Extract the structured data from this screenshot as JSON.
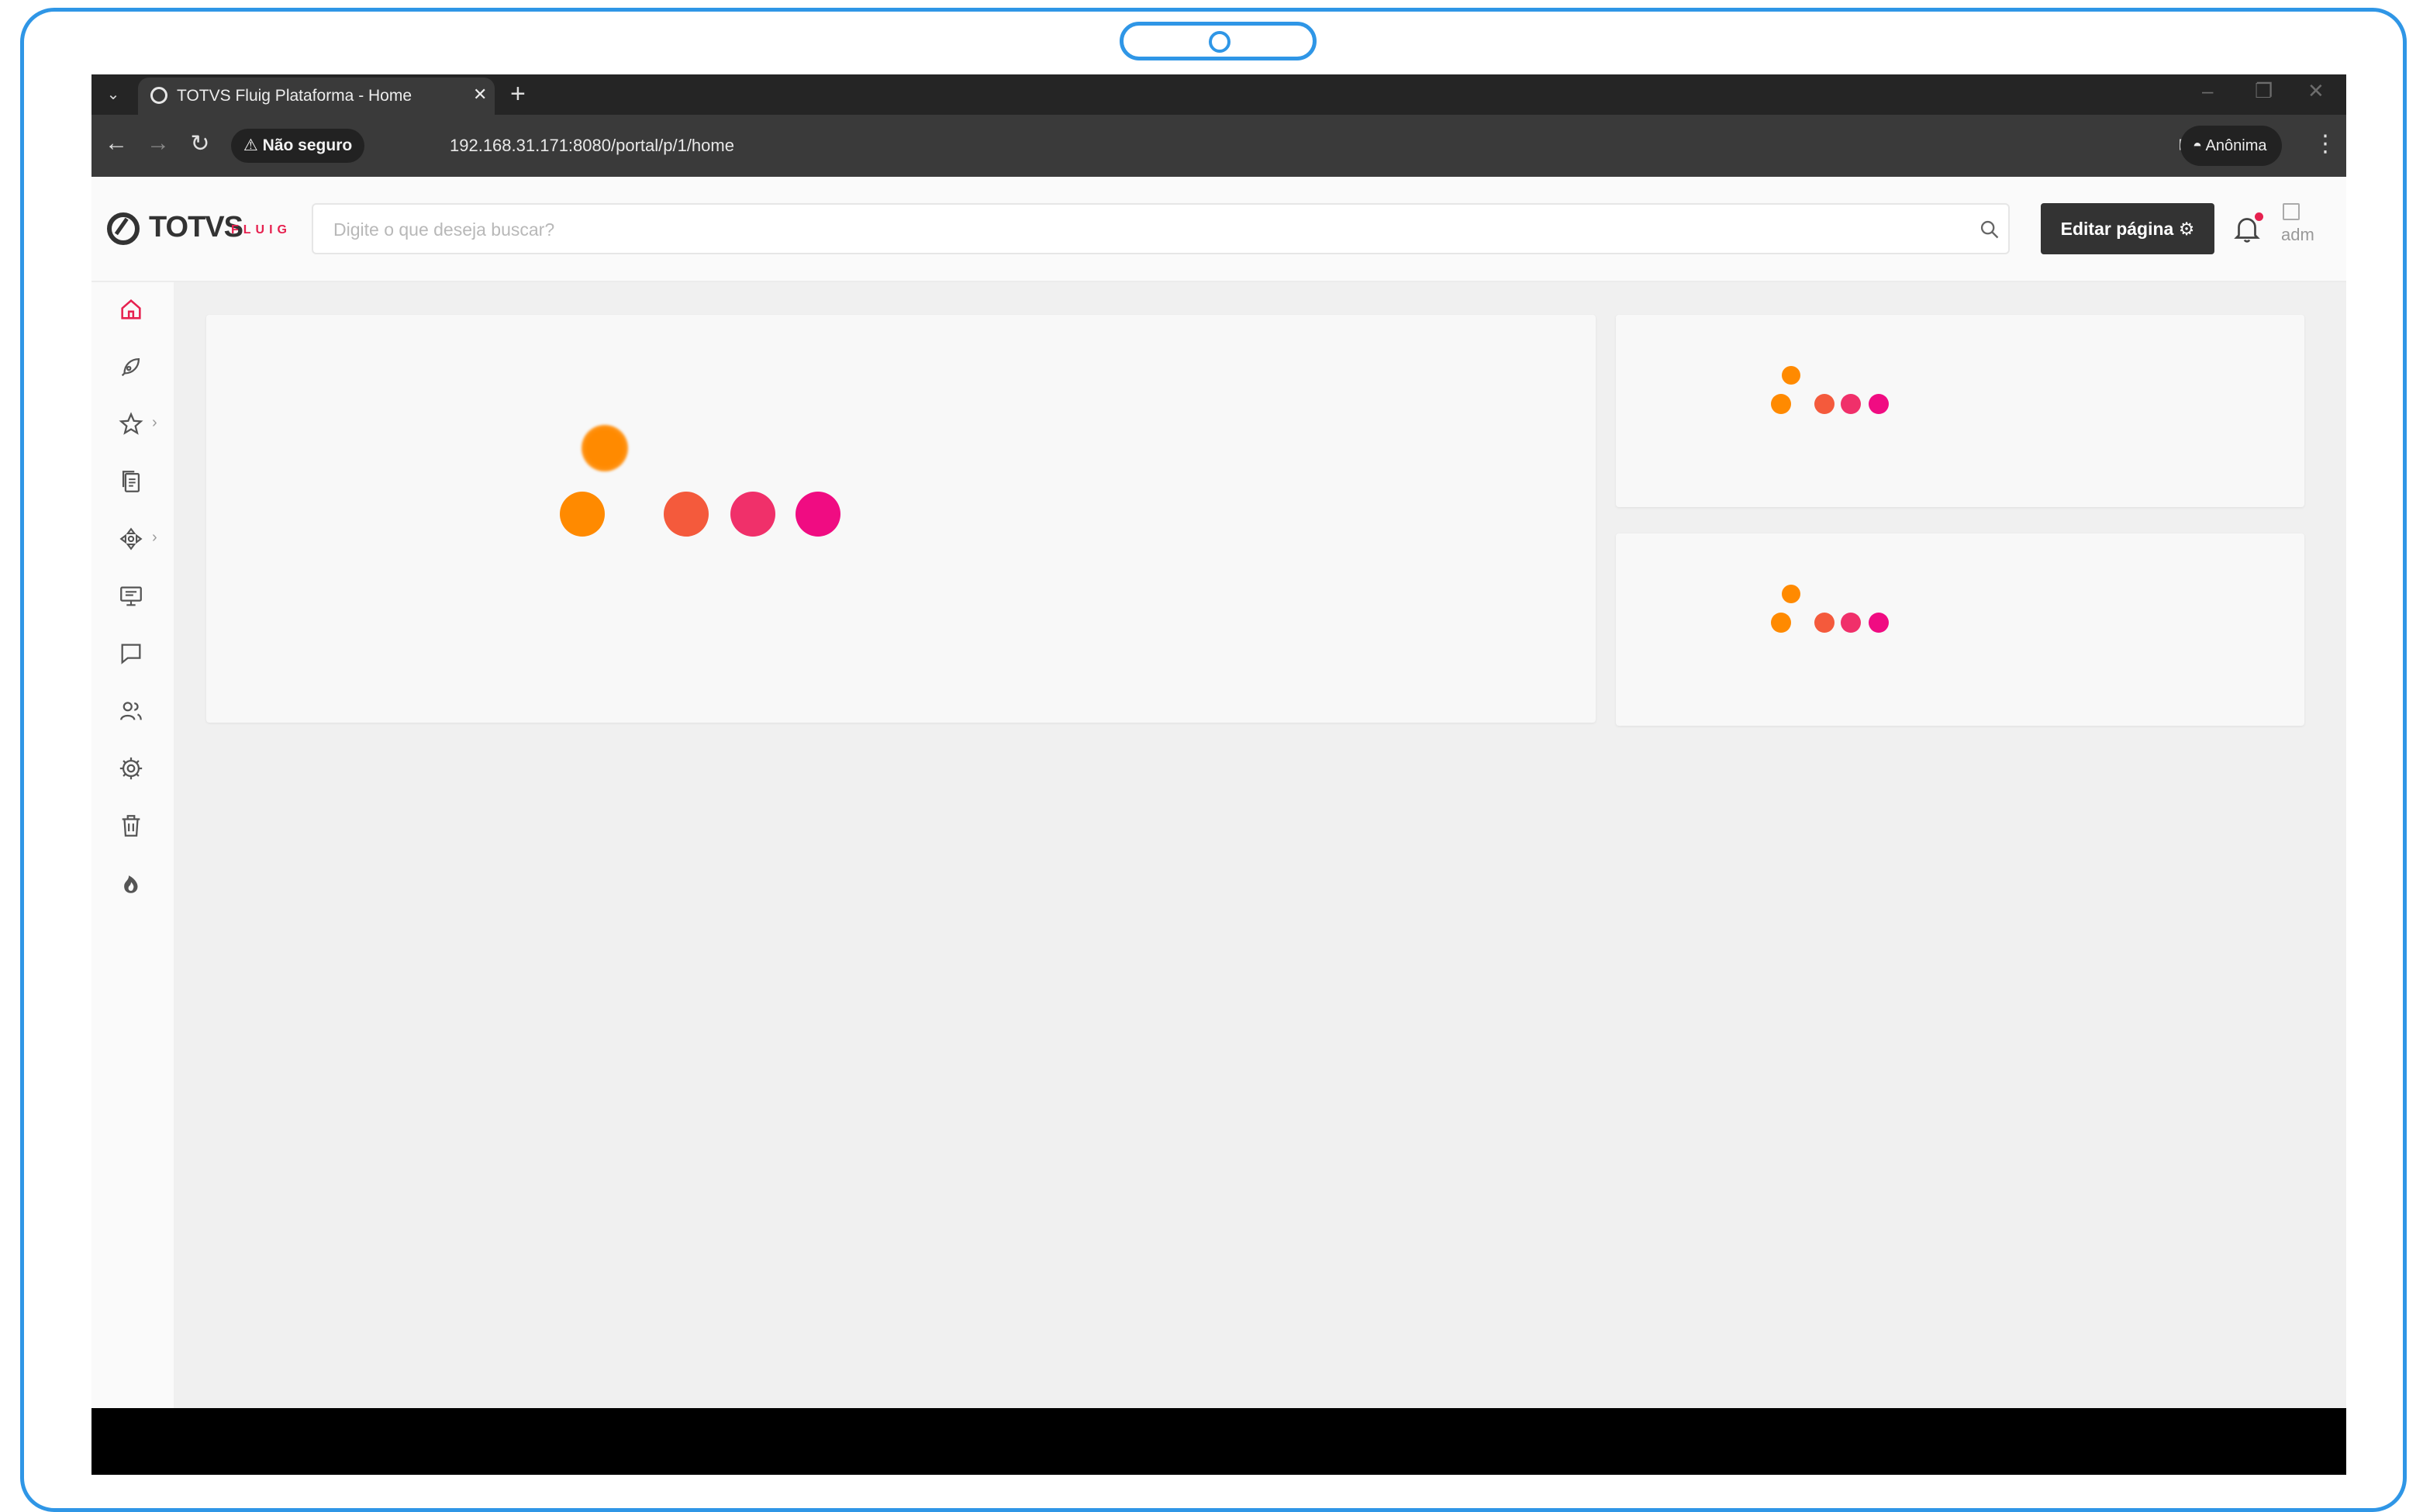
{
  "browser": {
    "tab_title": "TOTVS Fluig Plataforma - Home",
    "tab_close": "✕",
    "new_tab": "+",
    "security_label": "Não seguro",
    "url": "192.168.31.171:8080/portal/p/1/home",
    "profile_label": "Anônima"
  },
  "header": {
    "logo_text": "TOTVS",
    "logo_sub": "FLUIG",
    "search_placeholder": "Digite o que deseja buscar?",
    "edit_button": "Editar página",
    "avatar_alt": "adm"
  },
  "sidebar": {
    "items": [
      {
        "name": "home-icon",
        "active": true
      },
      {
        "name": "rocket-icon"
      },
      {
        "name": "star-icon",
        "has_submenu": true
      },
      {
        "name": "documents-icon"
      },
      {
        "name": "workflow-icon",
        "has_submenu": true
      },
      {
        "name": "presentation-icon"
      },
      {
        "name": "chat-icon"
      },
      {
        "name": "users-icon"
      },
      {
        "name": "settings-icon"
      },
      {
        "name": "trash-icon"
      },
      {
        "name": "fire-icon"
      }
    ]
  },
  "colors": {
    "accent": "#e6214f",
    "loader_orange": "#ff8a00",
    "loader_coral": "#f45a3c",
    "loader_pink": "#f0306a",
    "loader_magenta": "#f00c82",
    "frame": "#2f96e6"
  }
}
